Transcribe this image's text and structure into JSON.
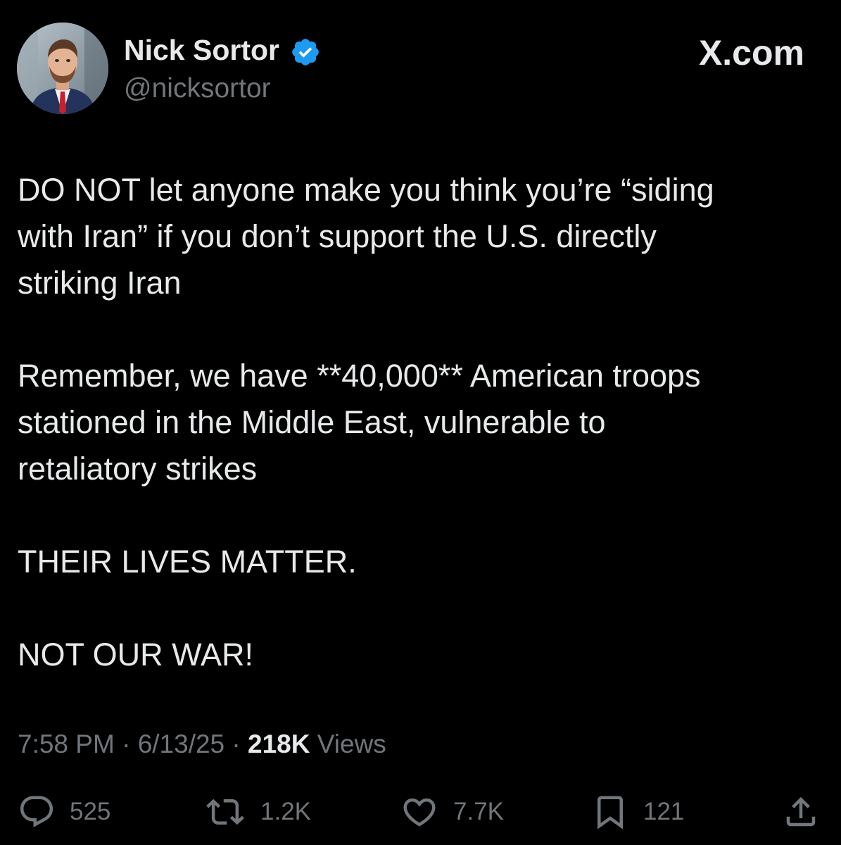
{
  "author": {
    "name": "Nick Sortor",
    "handle": "@nicksortor",
    "verified": true,
    "verified_color": "#1d9bf0",
    "avatar_icon": "profile-photo"
  },
  "brand": {
    "label": "X.com"
  },
  "tweet": {
    "paragraphs": [
      "DO NOT let anyone make you think you’re “siding\nwith Iran” if you don’t support the U.S. directly\nstriking Iran",
      "Remember, we have **40,000** American troops\nstationed in the Middle East, vulnerable to\nretaliatory strikes",
      "THEIR LIVES MATTER.",
      "NOT OUR WAR!"
    ]
  },
  "meta": {
    "time": "7:58 PM",
    "date": "6/13/25",
    "views_count": "218K",
    "views_label": "Views",
    "separator": "·"
  },
  "actions": {
    "replies": {
      "icon": "reply-icon",
      "count": "525"
    },
    "reposts": {
      "icon": "repost-icon",
      "count": "1.2K"
    },
    "likes": {
      "icon": "heart-icon",
      "count": "7.7K"
    },
    "bookmarks": {
      "icon": "bookmark-icon",
      "count": "121"
    },
    "share": {
      "icon": "share-icon"
    }
  },
  "colors": {
    "background": "#000000",
    "text_primary": "#e7e9ea",
    "text_secondary": "#71767b"
  }
}
